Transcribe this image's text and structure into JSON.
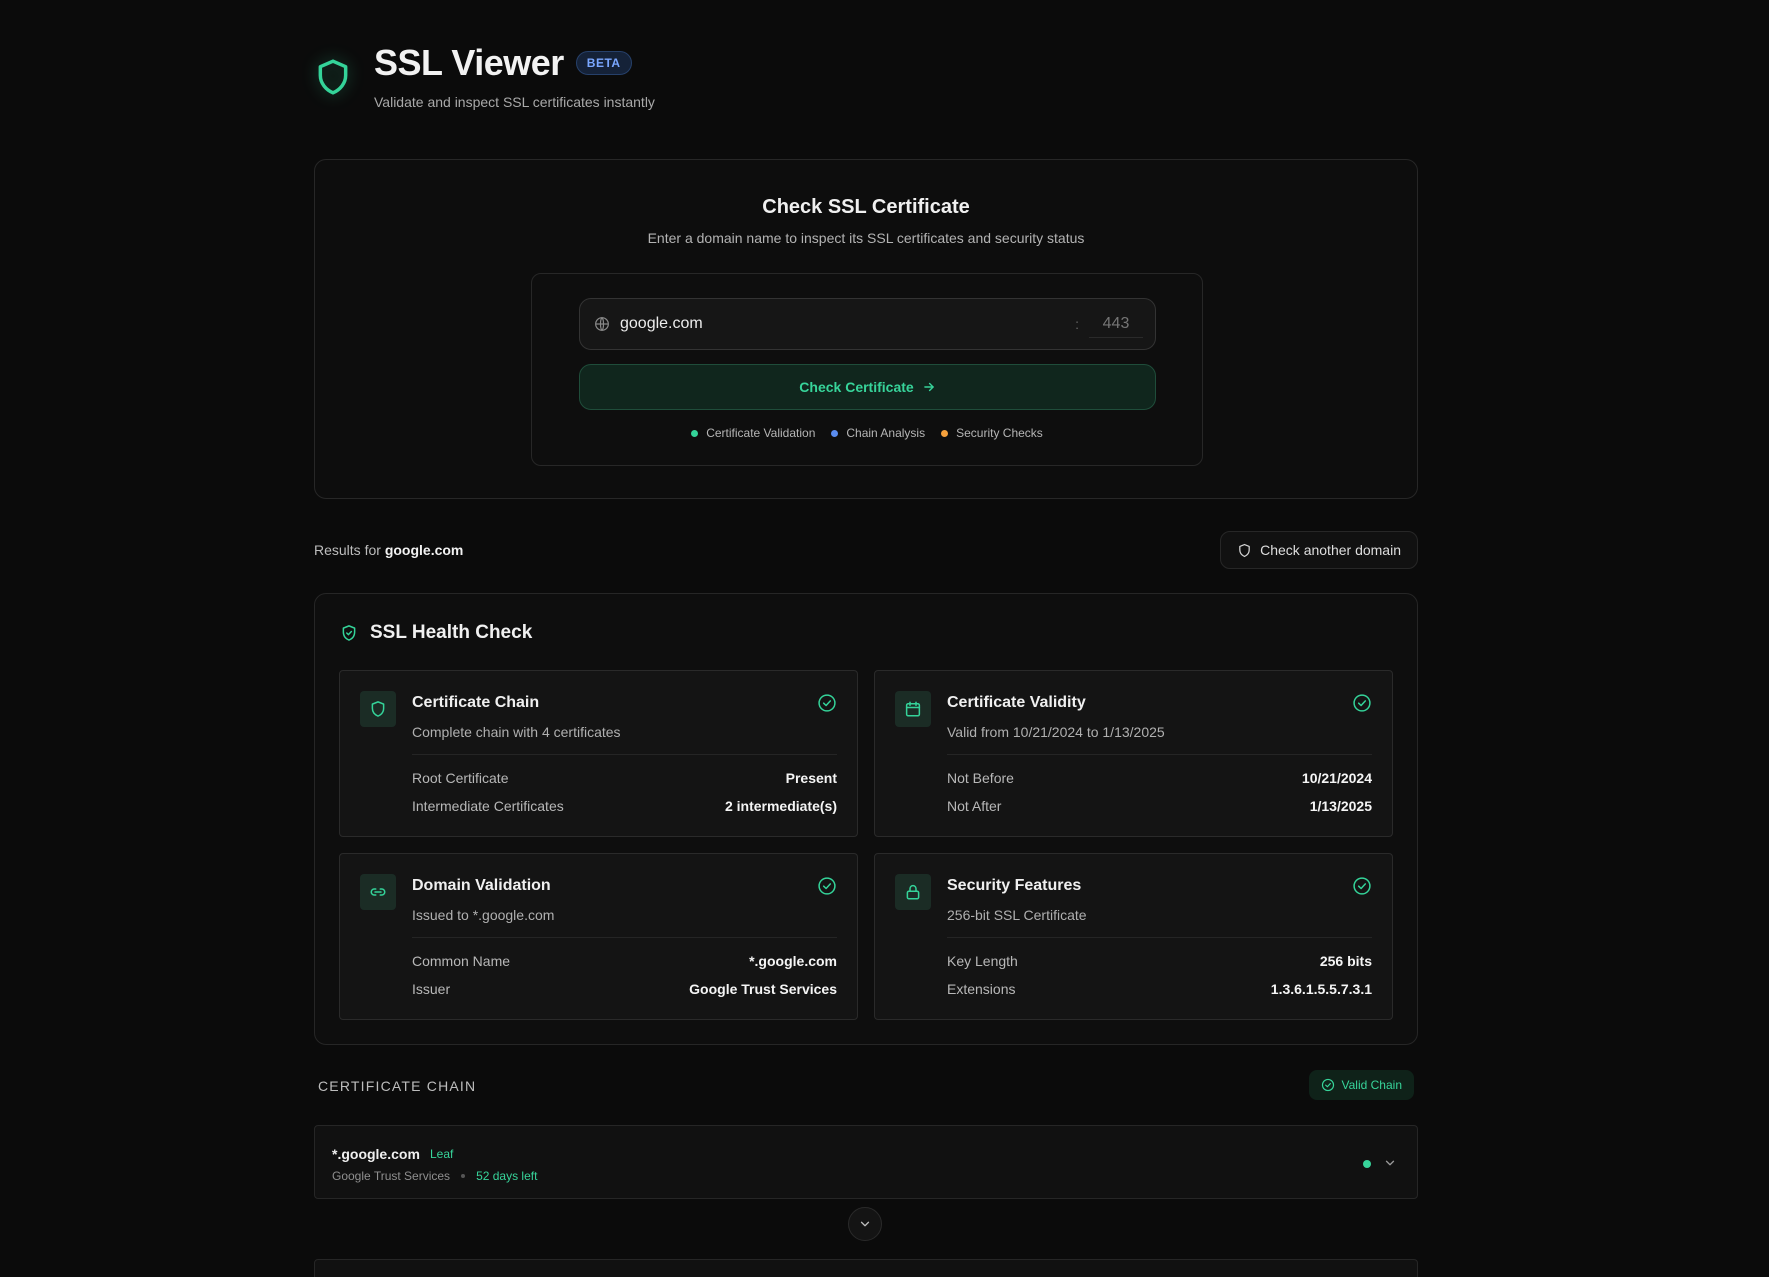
{
  "header": {
    "title": "SSL Viewer",
    "badge": "BETA",
    "subtitle": "Validate and inspect SSL certificates instantly"
  },
  "check": {
    "title": "Check SSL Certificate",
    "description": "Enter a domain name to inspect its SSL certificates and security status",
    "domain_value": "google.com",
    "port_separator": ":",
    "port_placeholder": "443",
    "button_label": "Check Certificate",
    "features": [
      {
        "label": "Certificate Validation",
        "color": "#34d399"
      },
      {
        "label": "Chain Analysis",
        "color": "#5b8def"
      },
      {
        "label": "Security Checks",
        "color": "#f5a13c"
      }
    ]
  },
  "results": {
    "prefix": "Results for",
    "domain": "google.com",
    "another_button": "Check another domain"
  },
  "health": {
    "title": "SSL Health Check",
    "cards": [
      {
        "icon": "shield-icon",
        "title": "Certificate Chain",
        "description": "Complete chain with 4 certificates",
        "rows": [
          {
            "key": "Root Certificate",
            "value": "Present"
          },
          {
            "key": "Intermediate Certificates",
            "value": "2 intermediate(s)"
          }
        ]
      },
      {
        "icon": "calendar-icon",
        "title": "Certificate Validity",
        "description": "Valid from 10/21/2024 to 1/13/2025",
        "rows": [
          {
            "key": "Not Before",
            "value": "10/21/2024"
          },
          {
            "key": "Not After",
            "value": "1/13/2025"
          }
        ]
      },
      {
        "icon": "link-icon",
        "title": "Domain Validation",
        "description": "Issued to *.google.com",
        "rows": [
          {
            "key": "Common Name",
            "value": "*.google.com"
          },
          {
            "key": "Issuer",
            "value": "Google Trust Services"
          }
        ]
      },
      {
        "icon": "lock-icon",
        "title": "Security Features",
        "description": "256-bit SSL Certificate",
        "rows": [
          {
            "key": "Key Length",
            "value": "256 bits"
          },
          {
            "key": "Extensions",
            "value": "1.3.6.1.5.5.7.3.1"
          }
        ]
      }
    ]
  },
  "chain": {
    "label": "CERTIFICATE CHAIN",
    "status": "Valid Chain",
    "items": [
      {
        "name": "*.google.com",
        "tag": "Leaf",
        "issuer": "Google Trust Services",
        "days_left": "52 days left"
      }
    ]
  },
  "colors": {
    "accent": "#34d399",
    "background": "#0b0b0b",
    "beta": "#7aa7ff"
  }
}
